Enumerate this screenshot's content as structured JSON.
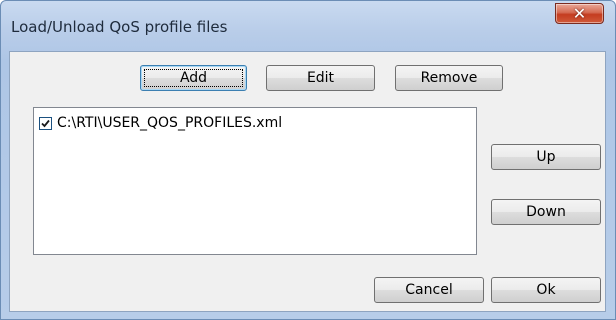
{
  "window": {
    "title": "Load/Unload QoS profile files"
  },
  "icons": {
    "close": "close-icon",
    "check": "checkmark-icon"
  },
  "colors": {
    "close_button": "#c9452a",
    "client_bg": "#f0f0f0",
    "title_bar": "#b9cde9"
  },
  "toolbar": {
    "add_label": "Add",
    "edit_label": "Edit",
    "remove_label": "Remove"
  },
  "files": [
    {
      "path": "C:\\RTI\\USER_QOS_PROFILES.xml",
      "checked": true
    }
  ],
  "side_buttons": {
    "up_label": "Up",
    "down_label": "Down"
  },
  "footer": {
    "cancel_label": "Cancel",
    "ok_label": "Ok"
  }
}
